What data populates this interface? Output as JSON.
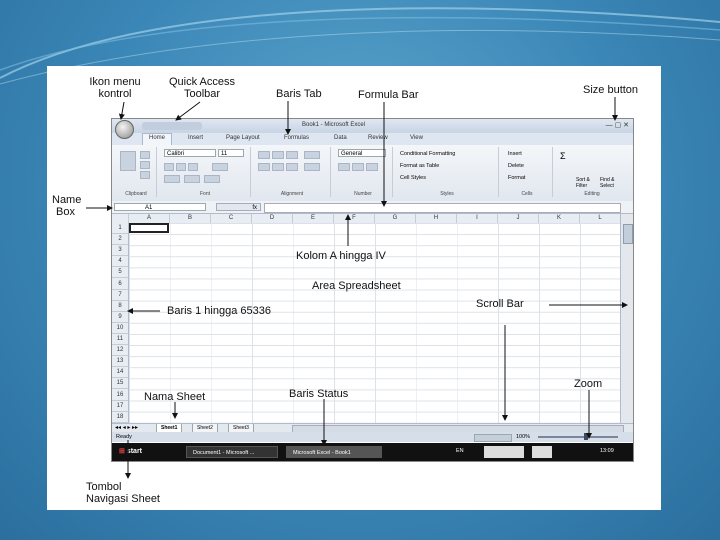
{
  "labels": {
    "control_menu": [
      "Ikon menu",
      "kontrol"
    ],
    "quick_access": [
      "Quick Access",
      "Toolbar"
    ],
    "tab_row": "Baris Tab",
    "formula_bar": "Formula Bar",
    "size_button": "Size button",
    "name_box": [
      "Name",
      "Box"
    ],
    "columns": "Kolom A hingga IV",
    "spreadsheet_area": "Area Spreadsheet",
    "rows": "Baris 1 hingga 65336",
    "scroll_bar": "Scroll  Bar",
    "zoom": "Zoom",
    "sheet_name": "Nama Sheet",
    "status_row": "Baris Status",
    "sheet_nav": [
      "Tombol",
      "Navigasi Sheet"
    ]
  },
  "excel": {
    "title": "Book1 - Microsoft Excel",
    "tabs": [
      "Home",
      "Insert",
      "Page Layout",
      "Formulas",
      "Data",
      "Review",
      "View"
    ],
    "ribbon": {
      "font_name": "Calibri",
      "font_size": "11",
      "number_format": "General",
      "styles": [
        "Conditional Formatting",
        "Format as Table",
        "Cell Styles"
      ],
      "cells": [
        "Insert",
        "Delete",
        "Format"
      ],
      "editing": [
        "Sort & Filter",
        "Find & Select"
      ],
      "groups": [
        "Clipboard",
        "Font",
        "Alignment",
        "Number",
        "Styles",
        "Cells",
        "Editing"
      ]
    },
    "name_box_value": "A1",
    "fx": "fx",
    "columns": [
      "A",
      "B",
      "C",
      "D",
      "E",
      "F",
      "G",
      "H",
      "I",
      "J",
      "K",
      "L"
    ],
    "rows": [
      "1",
      "2",
      "3",
      "4",
      "5",
      "6",
      "7",
      "8",
      "9",
      "10",
      "11",
      "12",
      "13",
      "14",
      "15",
      "16",
      "17",
      "18"
    ],
    "sheets": [
      "Sheet1",
      "Sheet2",
      "Sheet3"
    ],
    "status_ready": "Ready",
    "zoom": "100%",
    "taskbar": {
      "start": "start",
      "items": [
        "Document1 - Microsoft ...",
        "Microsoft Excel - Book1"
      ],
      "lang": "EN",
      "time": "13:09"
    }
  }
}
